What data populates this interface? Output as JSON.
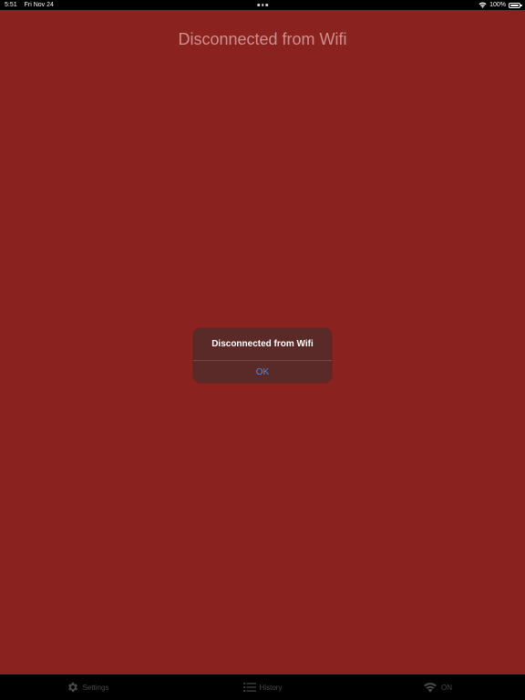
{
  "status_bar": {
    "time": "5:51",
    "date": "Fri Nov 24",
    "battery": "100%",
    "wifi_icon": "wifi-icon",
    "battery_icon": "battery-icon"
  },
  "page": {
    "title": "Disconnected from Wifi",
    "background_color": "#8a2320"
  },
  "alert": {
    "title": "Disconnected from Wifi",
    "ok_label": "OK"
  },
  "tab_bar": {
    "items": [
      {
        "label": "Settings",
        "icon": "gear-icon"
      },
      {
        "label": "History",
        "icon": "list-icon"
      },
      {
        "label": "ON",
        "icon": "wifi-icon"
      }
    ]
  }
}
